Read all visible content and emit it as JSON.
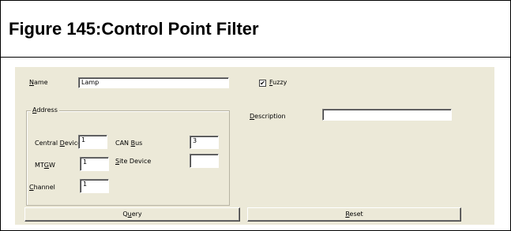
{
  "figure_title": "Figure 145:Control Point Filter",
  "dialog": {
    "name": {
      "label_pre": "",
      "label_u": "N",
      "label_post": "ame",
      "value": "Lamp"
    },
    "fuzzy": {
      "label_pre": "",
      "label_u": "F",
      "label_post": "uzzy",
      "checked": true,
      "check_mark": "✔"
    },
    "description": {
      "label_pre": "",
      "label_u": "D",
      "label_post": "escription",
      "value": ""
    },
    "address": {
      "legend_pre": "",
      "legend_u": "A",
      "legend_post": "ddress",
      "central_device": {
        "label_pre": "Central ",
        "label_u": "D",
        "label_post": "evice",
        "value": "1"
      },
      "can_bus": {
        "label_pre": "CAN ",
        "label_u": "B",
        "label_post": "us",
        "value": "3"
      },
      "mtgw": {
        "label_pre": "MT",
        "label_u": "G",
        "label_post": "W",
        "value": "1"
      },
      "site_device": {
        "label_pre": "",
        "label_u": "S",
        "label_post": "ite Device",
        "value": ""
      },
      "channel": {
        "label_pre": "",
        "label_u": "C",
        "label_post": "hannel",
        "value": "1"
      }
    },
    "buttons": {
      "query": {
        "pre": "Q",
        "u": "u",
        "post": "ery"
      },
      "reset": {
        "pre": "",
        "u": "R",
        "post": "eset"
      }
    }
  }
}
